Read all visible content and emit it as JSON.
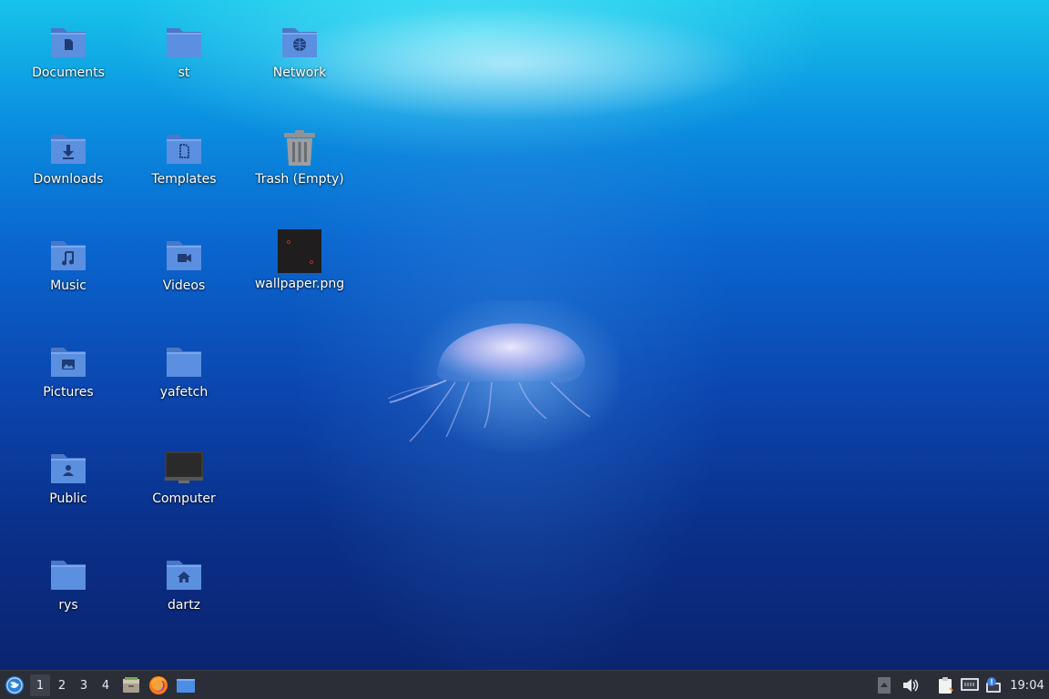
{
  "desktop": {
    "icons": [
      {
        "label": "Documents",
        "icon": "folder-documents-icon"
      },
      {
        "label": "st",
        "icon": "folder-icon"
      },
      {
        "label": "Network",
        "icon": "folder-network-icon"
      },
      {
        "label": "Downloads",
        "icon": "folder-downloads-icon"
      },
      {
        "label": "Templates",
        "icon": "folder-templates-icon"
      },
      {
        "label": "Trash (Empty)",
        "icon": "trash-empty-icon"
      },
      {
        "label": "Music",
        "icon": "folder-music-icon"
      },
      {
        "label": "Videos",
        "icon": "folder-videos-icon"
      },
      {
        "label": "wallpaper.png",
        "icon": "image-thumbnail-icon"
      },
      {
        "label": "Pictures",
        "icon": "folder-pictures-icon"
      },
      {
        "label": "yafetch",
        "icon": "folder-icon"
      },
      {
        "label": "Public",
        "icon": "folder-public-icon"
      },
      {
        "label": "Computer",
        "icon": "computer-icon"
      },
      {
        "label": "rys",
        "icon": "folder-icon"
      },
      {
        "label": "dartz",
        "icon": "folder-home-icon"
      }
    ]
  },
  "taskbar": {
    "workspaces": [
      "1",
      "2",
      "3",
      "4"
    ],
    "active_workspace": "1",
    "clock": "19:04"
  },
  "colors": {
    "folder": "#5b8fe0",
    "folder_tab": "#4a78c6",
    "taskbar": "#2b2e37"
  }
}
